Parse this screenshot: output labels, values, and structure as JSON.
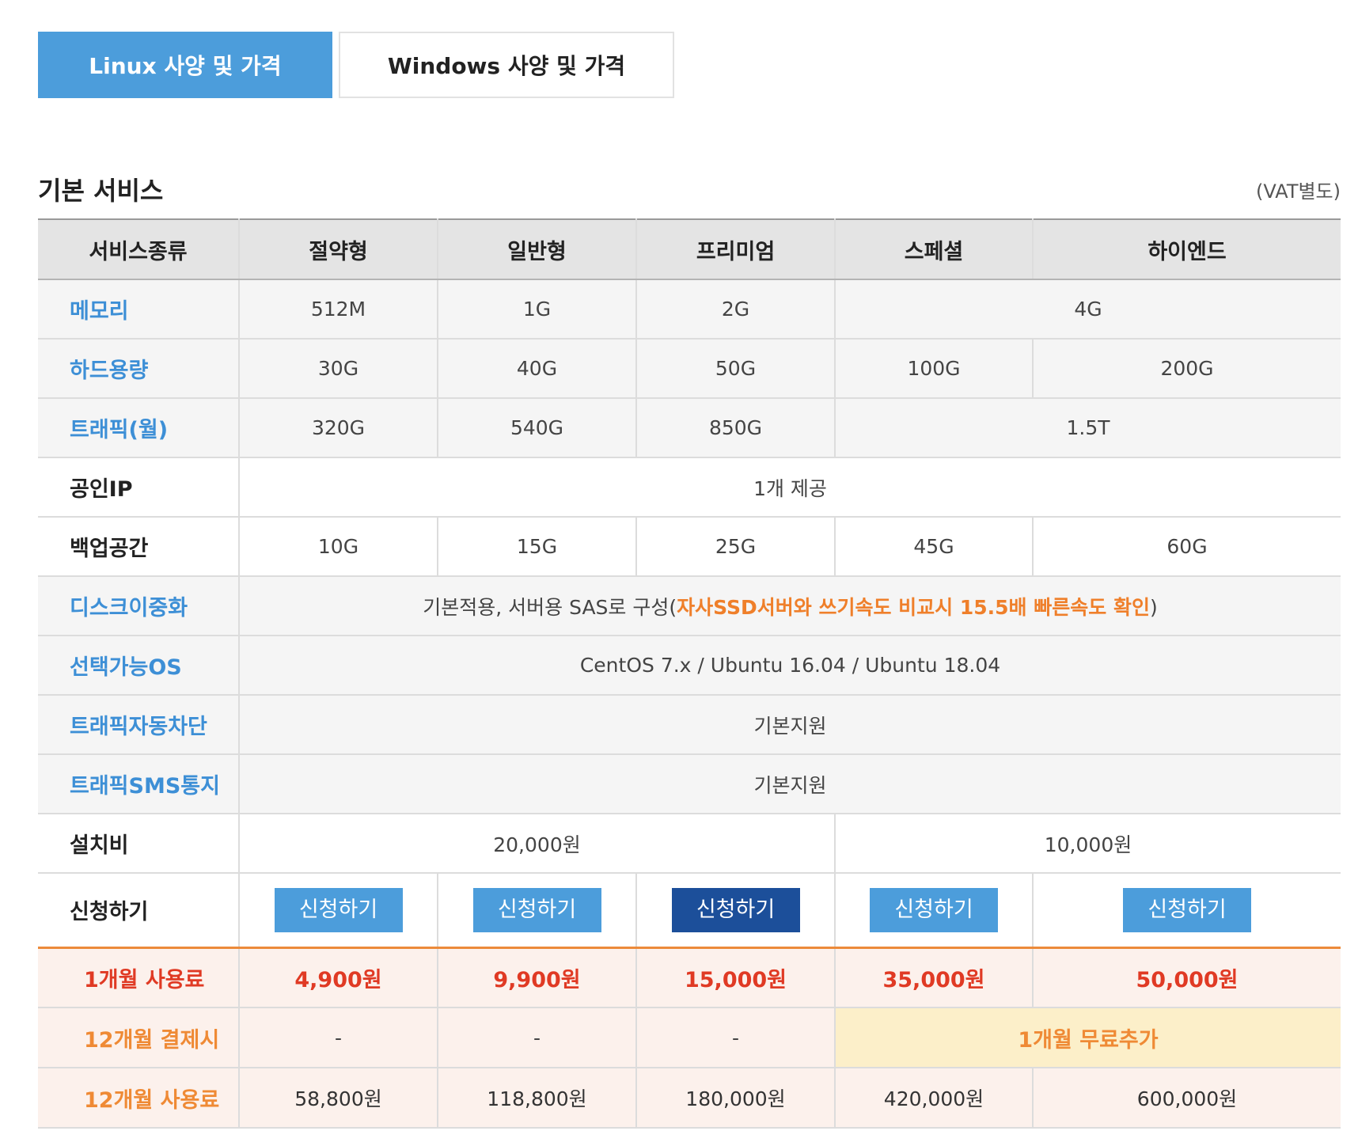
{
  "tabs": [
    {
      "label": "Linux 사양 및 가격",
      "active": true
    },
    {
      "label": "Windows 사양 및 가격",
      "active": false
    }
  ],
  "section": {
    "title": "기본 서비스",
    "vat_note": "(VAT별도)"
  },
  "table": {
    "headers": [
      "서비스종류",
      "절약형",
      "일반형",
      "프리미엄",
      "스페셜",
      "하이엔드"
    ],
    "rows": {
      "memory": {
        "label": "메모리",
        "values": [
          "512M",
          "1G",
          "2G",
          "4G"
        ]
      },
      "disk": {
        "label": "하드용량",
        "values": [
          "30G",
          "40G",
          "50G",
          "100G",
          "200G"
        ]
      },
      "traffic": {
        "label": "트래픽(월)",
        "values": [
          "320G",
          "540G",
          "850G",
          "1.5T"
        ]
      },
      "public_ip": {
        "label": "공인IP",
        "value": "1개 제공"
      },
      "backup": {
        "label": "백업공간",
        "values": [
          "10G",
          "15G",
          "25G",
          "45G",
          "60G"
        ]
      },
      "disk_dup": {
        "label": "디스크이중화",
        "value_prefix": "기본적용, 서버용 SAS로 구성(",
        "value_highlight": "자사SSD서버와 쓰기속도 비교시 15.5배 빠른속도 확인",
        "value_suffix": ")"
      },
      "os": {
        "label": "선택가능OS",
        "value": "CentOS 7.x / Ubuntu 16.04 / Ubuntu 18.04"
      },
      "traffic_block": {
        "label": "트래픽자동차단",
        "value": "기본지원"
      },
      "traffic_sms": {
        "label": "트래픽SMS통지",
        "value": "기본지원"
      },
      "setup_fee": {
        "label": "설치비",
        "values": [
          "20,000원",
          "10,000원"
        ]
      },
      "apply": {
        "label": "신청하기",
        "button_label": "신청하기"
      },
      "monthly": {
        "label": "1개월 사용료",
        "values": [
          "4,900원",
          "9,900원",
          "15,000원",
          "35,000원",
          "50,000원"
        ]
      },
      "yearly_pay": {
        "label": "12개월 결제시",
        "values": [
          "-",
          "-",
          "-"
        ],
        "bonus": "1개월 무료추가"
      },
      "yearly_fee": {
        "label": "12개월 사용료",
        "values": [
          "58,800원",
          "118,800원",
          "180,000원",
          "420,000원",
          "600,000원"
        ]
      }
    }
  },
  "colors": {
    "accent_blue": "#4c9ddb",
    "dark_blue": "#1c4f9a",
    "price_red": "#e03a24",
    "orange": "#ef8a35",
    "highlight_bg": "#fcefc9"
  }
}
